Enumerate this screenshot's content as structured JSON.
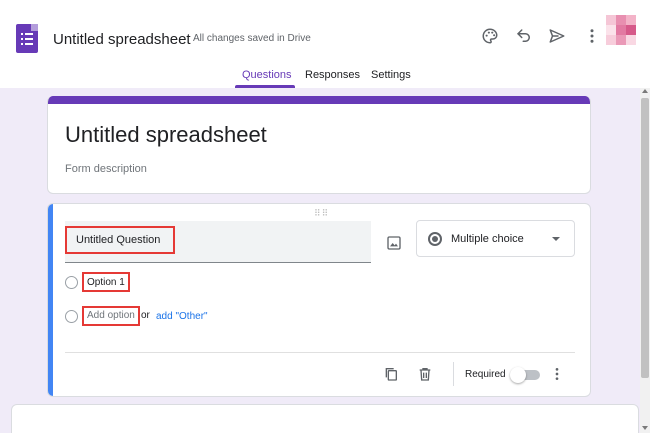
{
  "header": {
    "app_icon": "google-forms-icon",
    "doc_title": "Untitled spreadsheet",
    "save_status": "All changes saved in Drive",
    "actions": [
      {
        "name": "palette-icon"
      },
      {
        "name": "undo-icon"
      },
      {
        "name": "send-icon"
      },
      {
        "name": "more-vert-icon"
      }
    ],
    "avatar_colors": [
      "#f5c6d6",
      "#e88fb0",
      "#f3b3c8",
      "#fbe2ea",
      "#e27aa2",
      "#d65a8a",
      "#f7cddb",
      "#ea99b7",
      "#f9d8e3"
    ]
  },
  "tabs": [
    {
      "label": "Questions",
      "active": true
    },
    {
      "label": "Responses",
      "active": false
    },
    {
      "label": "Settings",
      "active": false
    }
  ],
  "form": {
    "title": "Untitled spreadsheet",
    "description_placeholder": "Form description"
  },
  "question": {
    "title": "Untitled Question",
    "type": "Multiple choice",
    "options": [
      "Option 1"
    ],
    "add_option_label": "Add option",
    "or_label": "or",
    "add_other_label": "add \"Other\"",
    "required_label": "Required",
    "required_on": false
  },
  "colors": {
    "accent": "#673ab7",
    "highlight_box": "#e53935",
    "active_card_bar": "#4285f4",
    "link": "#1a73e8",
    "background": "#f0ebf8"
  }
}
